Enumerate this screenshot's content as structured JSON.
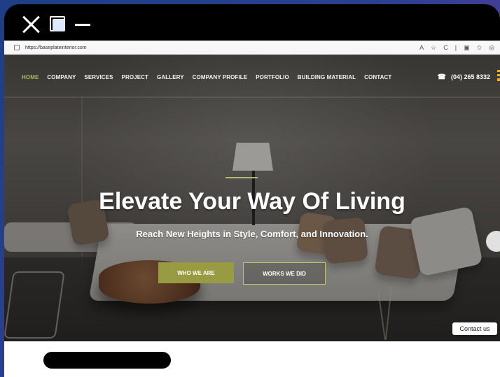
{
  "browser": {
    "url": "https://baseplateinterior.com",
    "toolbar_icons": [
      "A",
      "☆",
      "C",
      "|",
      "▣",
      "✩",
      "◎"
    ]
  },
  "nav": {
    "items": [
      "HOME",
      "COMPANY",
      "SERVICES",
      "PROJECT",
      "GALLERY",
      "COMPANY PROFILE",
      "PORTFOLIO",
      "BUILDING MATERIAL",
      "CONTACT"
    ],
    "phone": "(04) 265 8332"
  },
  "hero": {
    "title": "Elevate Your Way Of Living",
    "subtitle": "Reach New Heights in Style, Comfort, and Innovation.",
    "primary_button": "WHO WE ARE",
    "secondary_button": "WORKS WE DID"
  },
  "widget": {
    "contact_label": "Contact us"
  },
  "colors": {
    "accent": "#999b42",
    "active_nav": "#aeb46a",
    "phone_menu": "#f0b12f"
  }
}
